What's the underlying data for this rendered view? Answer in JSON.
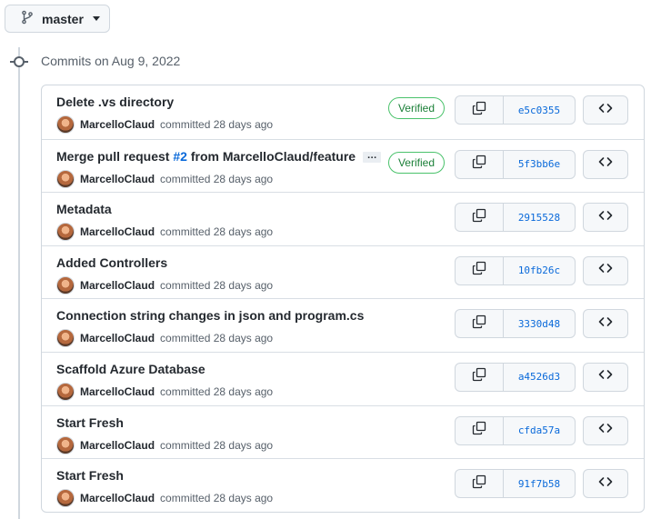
{
  "branch": {
    "name": "master"
  },
  "timeline": {
    "title": "Commits on Aug 9, 2022"
  },
  "commits": [
    {
      "title": "Delete .vs directory",
      "author": "MarcelloClaud",
      "meta": "committed 28 days ago",
      "verified": "Verified",
      "sha": "e5c0355"
    },
    {
      "title_prefix": "Merge pull request ",
      "pr": "#2",
      "title_suffix": " from MarcelloClaud/feature",
      "ellipsis": "…",
      "author": "MarcelloClaud",
      "meta": "committed 28 days ago",
      "verified": "Verified",
      "sha": "5f3bb6e"
    },
    {
      "title": "Metadata",
      "author": "MarcelloClaud",
      "meta": "committed 28 days ago",
      "sha": "2915528"
    },
    {
      "title": "Added Controllers",
      "author": "MarcelloClaud",
      "meta": "committed 28 days ago",
      "sha": "10fb26c"
    },
    {
      "title": "Connection string changes in json and program.cs",
      "author": "MarcelloClaud",
      "meta": "committed 28 days ago",
      "sha": "3330d48"
    },
    {
      "title": "Scaffold Azure Database",
      "author": "MarcelloClaud",
      "meta": "committed 28 days ago",
      "sha": "a4526d3"
    },
    {
      "title": "Start Fresh",
      "author": "MarcelloClaud",
      "meta": "committed 28 days ago",
      "sha": "cfda57a"
    },
    {
      "title": "Start Fresh",
      "author": "MarcelloClaud",
      "meta": "committed 28 days ago",
      "sha": "91f7b58"
    }
  ],
  "icons": {
    "branch": "git-branch-icon",
    "copy": "copy-icon",
    "browse": "code-icon",
    "timeline": "git-commit-icon"
  },
  "colors": {
    "link": "#0969da",
    "verified": "#1a7f37",
    "border": "#d0d7de",
    "muted": "#57606a"
  }
}
